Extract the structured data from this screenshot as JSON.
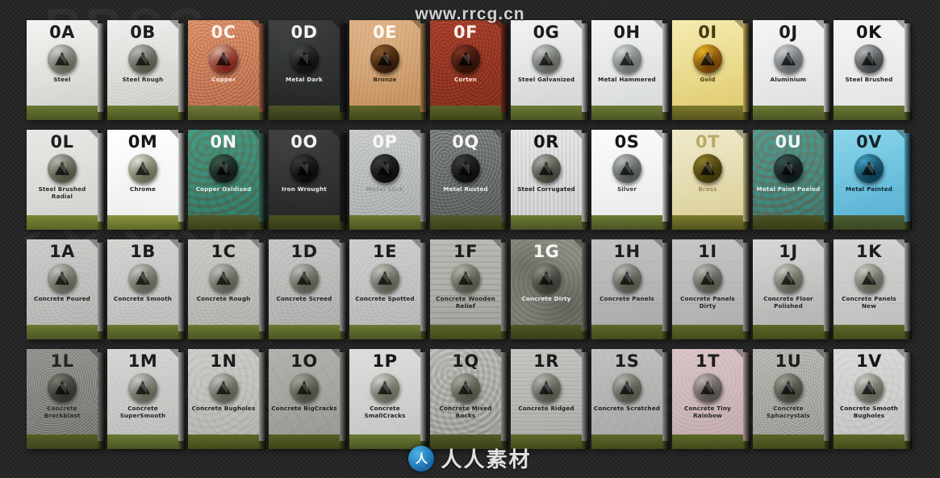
{
  "watermarks": {
    "top_center": "www.rrcg.cn",
    "logo_mark": "人",
    "logo_text": "人人素材",
    "background_repeats": [
      "RRCG",
      "www.rrcg.cn",
      "人人素材",
      "RRCG"
    ]
  },
  "grid": {
    "columns": 11,
    "rows": 4,
    "tiles": [
      {
        "code": "0A",
        "label": "Steel",
        "face_top": "#f2f2f0",
        "face_bot": "#d4d4d0",
        "side": "#b8b8b4",
        "base_top": "#6b7a33",
        "base_bot": "#4a5524",
        "code_color": "#1c1c1c",
        "label_color": "#262626",
        "knob_a": "#cfd2cf",
        "knob_b": "#5d6153",
        "texture": "smooth"
      },
      {
        "code": "0B",
        "label": "Steel Rough",
        "face_top": "#efefee",
        "face_bot": "#cfcfca",
        "side": "#b4b4b0",
        "base_top": "#6b7a33",
        "base_bot": "#49541f",
        "code_color": "#1c1c1c",
        "label_color": "#2a2a2a",
        "knob_a": "#b9bcb7",
        "knob_b": "#4f5346",
        "texture": "rough"
      },
      {
        "code": "0C",
        "label": "Copper",
        "face_top": "#d98f6a",
        "face_bot": "#b96f4e",
        "side": "#9a5a3e",
        "base_top": "#6e7b38",
        "base_bot": "#4d5622",
        "code_color": "#fdf2ec",
        "label_color": "#fbe8df",
        "knob_a": "#d9b09a",
        "knob_b": "#7a1c14",
        "texture": "rough"
      },
      {
        "code": "0D",
        "label": "Metal Dark",
        "face_top": "#3a3c3d",
        "face_bot": "#232526",
        "side": "#1a1c1d",
        "base_top": "#4c5425",
        "base_bot": "#343a18",
        "code_color": "#f4f4f4",
        "label_color": "#e8e8e8",
        "knob_a": "#4a4c4d",
        "knob_b": "#0c0d0e",
        "texture": "smoke"
      },
      {
        "code": "0E",
        "label": "Bronze",
        "face_top": "#ddb083",
        "face_bot": "#c4905f",
        "side": "#a2764c",
        "base_top": "#5e6528",
        "base_bot": "#41481a",
        "code_color": "#fffaf2",
        "label_color": "#3b2615",
        "knob_a": "#8a5a2e",
        "knob_b": "#2f1708",
        "texture": "paper"
      },
      {
        "code": "0F",
        "label": "Corten",
        "face_top": "#a63f2b",
        "face_bot": "#86301f",
        "side": "#6e2717",
        "base_top": "#5c6429",
        "base_bot": "#3f4618",
        "code_color": "#fff1ea",
        "label_color": "#fde3d8",
        "knob_a": "#7e3523",
        "knob_b": "#2b0f07",
        "texture": "rough"
      },
      {
        "code": "0G",
        "label": "Steel Galvanized",
        "face_top": "#f0f1f1",
        "face_bot": "#d6d8d8",
        "side": "#bbbdbd",
        "base_top": "#6b7a33",
        "base_bot": "#4a5524",
        "code_color": "#1b1b1b",
        "label_color": "#232323",
        "knob_a": "#c6c9c8",
        "knob_b": "#5b5f58",
        "texture": "smooth"
      },
      {
        "code": "0H",
        "label": "Metal Hammered",
        "face_top": "#f1f2f3",
        "face_bot": "#dadcdd",
        "side": "#bebfc0",
        "base_top": "#6b7a33",
        "base_bot": "#4a5524",
        "code_color": "#1b1b1b",
        "label_color": "#232323",
        "knob_a": "#d4d7d8",
        "knob_b": "#6a6e6c",
        "texture": "smooth"
      },
      {
        "code": "0I",
        "label": "Gold",
        "face_top": "#f4e9a8",
        "face_bot": "#e2cf78",
        "side": "#bda84f",
        "base_top": "#7b7a2c",
        "base_bot": "#56541c",
        "code_color": "#453a10",
        "label_color": "#4a3e12",
        "knob_a": "#e6b525",
        "knob_b": "#6b3a06",
        "texture": "smooth"
      },
      {
        "code": "0J",
        "label": "Aluminium",
        "face_top": "#f4f4f4",
        "face_bot": "#e2e2e2",
        "side": "#c5c5c5",
        "base_top": "#6b7a33",
        "base_bot": "#4a5524",
        "code_color": "#1b1b1b",
        "label_color": "#242424",
        "knob_a": "#cdd0d2",
        "knob_b": "#5f6466",
        "texture": "smooth"
      },
      {
        "code": "0K",
        "label": "Steel Brushed",
        "face_top": "#f5f5f5",
        "face_bot": "#e4e4e4",
        "side": "#c6c6c6",
        "base_top": "#6b7a33",
        "base_bot": "#4a5524",
        "code_color": "#141414",
        "label_color": "#222222",
        "knob_a": "#b8bbbc",
        "knob_b": "#3e4244",
        "texture": "brush"
      },
      {
        "code": "0L",
        "label": "Steel Brushed Radial",
        "face_top": "#e8e8e6",
        "face_bot": "#d3d3cf",
        "side": "#b5b5b1",
        "base_top": "#7d8736",
        "base_bot": "#5a6325",
        "code_color": "#1e1e1e",
        "label_color": "#2b2b2b",
        "knob_a": "#b6b8ae",
        "knob_b": "#4b4e3f",
        "texture": "radial"
      },
      {
        "code": "0M",
        "label": "Chrome",
        "face_top": "#ffffff",
        "face_bot": "#ededeb",
        "side": "#cfcfcd",
        "base_top": "#8b9440",
        "base_bot": "#5f6828",
        "code_color": "#161616",
        "label_color": "#242424",
        "knob_a": "#dfe2da",
        "knob_b": "#60664c",
        "texture": "chrome"
      },
      {
        "code": "0N",
        "label": "Copper Oxidised",
        "face_top": "#4f9b8a",
        "face_bot": "#3b7f72",
        "side": "#2f665c",
        "base_top": "#4f5a26",
        "base_bot": "#3a4219",
        "code_color": "#f4f7f5",
        "label_color": "#e4efe9",
        "knob_a": "#3a5a4c",
        "knob_b": "#101a15",
        "texture": "oxide"
      },
      {
        "code": "0O",
        "label": "Iron Wrought",
        "face_top": "#3c3c3c",
        "face_bot": "#262626",
        "side": "#1c1c1c",
        "base_top": "#4a5222",
        "base_bot": "#343a17",
        "code_color": "#f2f2f2",
        "label_color": "#ececec",
        "knob_a": "#3a3a3a",
        "knob_b": "#080808",
        "texture": "smoke"
      },
      {
        "code": "0P",
        "label": "Metal Slick",
        "face_top": "#c9cbcb",
        "face_bot": "#adb0b0",
        "side": "#939696",
        "base_top": "#6e7a33",
        "base_bot": "#4d5522",
        "code_color": "#f6f6f6",
        "label_color": "#8e9191",
        "knob_a": "#3c3e3e",
        "knob_b": "#0a0b0b",
        "texture": "rough"
      },
      {
        "code": "0Q",
        "label": "Metal Rusted",
        "face_top": "#7c7f80",
        "face_bot": "#5e6162",
        "side": "#4a4d4e",
        "base_top": "#525a27",
        "base_bot": "#3b421a",
        "code_color": "#f4f4f4",
        "label_color": "#ededed",
        "knob_a": "#3b3d3d",
        "knob_b": "#0b0c0c",
        "texture": "rough"
      },
      {
        "code": "0R",
        "label": "Steel Corrugated",
        "face_top": "#e3e4e4",
        "face_bot": "#cbcccc",
        "side": "#aeafaf",
        "base_top": "#6b7a33",
        "base_bot": "#4a5524",
        "code_color": "#151515",
        "label_color": "#1d1d1d",
        "knob_a": "#a9aca4",
        "knob_b": "#3b3f34",
        "texture": "corrugated"
      },
      {
        "code": "0S",
        "label": "Silver",
        "face_top": "#fbfbfb",
        "face_bot": "#ececec",
        "side": "#cdcdcd",
        "base_top": "#6b7a33",
        "base_bot": "#4a5524",
        "code_color": "#161616",
        "label_color": "#3a3a3a",
        "knob_a": "#b9bcbd",
        "knob_b": "#4d5152",
        "texture": "smooth"
      },
      {
        "code": "0T",
        "label": "Brass",
        "face_top": "#efe8c6",
        "face_bot": "#ddd3a0",
        "side": "#b9ae77",
        "base_top": "#7a7a2e",
        "base_bot": "#55551e",
        "code_color": "#b9ab68",
        "label_color": "#9c8f52",
        "knob_a": "#8d7c2a",
        "knob_b": "#3c3509",
        "texture": "smooth"
      },
      {
        "code": "0U",
        "label": "Metal Paint Peeled",
        "face_top": "#5d9b96",
        "face_bot": "#47817d",
        "side": "#386965",
        "base_top": "#4a5424",
        "base_bot": "#363d18",
        "code_color": "#eef5f4",
        "label_color": "#e2efed",
        "knob_a": "#3a5252",
        "knob_b": "#0e1616",
        "texture": "oxide"
      },
      {
        "code": "0V",
        "label": "Metal Painted",
        "face_top": "#7fd0e8",
        "face_bot": "#5fb7d6",
        "side": "#4a9ab8",
        "base_top": "#4d6038",
        "base_bot": "#39471f",
        "code_color": "#11262c",
        "label_color": "#10262c",
        "knob_a": "#3e9fc4",
        "knob_b": "#0c3b4d",
        "texture": "smooth"
      },
      {
        "code": "1A",
        "label": "Concrete Poured",
        "face_top": "#cbcbc9",
        "face_bot": "#b4b4b2",
        "side": "#9a9a98",
        "base_top": "#6b7a33",
        "base_bot": "#4a5524",
        "code_color": "#1d1d1d",
        "label_color": "#222222",
        "knob_a": "#c2c4bd",
        "knob_b": "#585c4e",
        "texture": "concrete"
      },
      {
        "code": "1B",
        "label": "Concrete Smooth",
        "face_top": "#d3d3d1",
        "face_bot": "#bcbcba",
        "side": "#a1a1a0",
        "base_top": "#6b7a33",
        "base_bot": "#4a5524",
        "code_color": "#1d1d1d",
        "label_color": "#222222",
        "knob_a": "#c6c8c1",
        "knob_b": "#5a5e50",
        "texture": "concrete"
      },
      {
        "code": "1C",
        "label": "Concrete Rough",
        "face_top": "#c9c9c6",
        "face_bot": "#b1b1ae",
        "side": "#979795",
        "base_top": "#6b7a33",
        "base_bot": "#4a5524",
        "code_color": "#1d1d1d",
        "label_color": "#222222",
        "knob_a": "#c0c2bb",
        "knob_b": "#55594b",
        "texture": "concrete"
      },
      {
        "code": "1D",
        "label": "Concrete Screed",
        "face_top": "#c6c6c4",
        "face_bot": "#aeaeac",
        "side": "#949492",
        "base_top": "#6b7a33",
        "base_bot": "#4a5524",
        "code_color": "#1d1d1d",
        "label_color": "#222222",
        "knob_a": "#bcbeb7",
        "knob_b": "#525648",
        "texture": "concrete"
      },
      {
        "code": "1E",
        "label": "Concrete Spotted",
        "face_top": "#cecece",
        "face_bot": "#b7b7b7",
        "side": "#9c9c9c",
        "base_top": "#6b7a33",
        "base_bot": "#4a5524",
        "code_color": "#1d1d1d",
        "label_color": "#222222",
        "knob_a": "#c2c4bd",
        "knob_b": "#56594c",
        "texture": "concrete"
      },
      {
        "code": "1F",
        "label": "Concrete Wooden Relief",
        "face_top": "#b8b8b2",
        "face_bot": "#a0a09a",
        "side": "#878781",
        "base_top": "#5b6528",
        "base_bot": "#41481a",
        "code_color": "#1d1d1d",
        "label_color": "#222222",
        "knob_a": "#b4b6ad",
        "knob_b": "#4c5043",
        "texture": "wood"
      },
      {
        "code": "1G",
        "label": "Concrete Dirty",
        "face_top": "#8f9288",
        "face_bot": "#76796f",
        "side": "#63665c",
        "base_top": "#4e5724",
        "base_bot": "#383f18",
        "code_color": "#f6f6f6",
        "label_color": "#f0f0f0",
        "knob_a": "#8e9188",
        "knob_b": "#33372c",
        "texture": "dirty"
      },
      {
        "code": "1H",
        "label": "Concrete Panels",
        "face_top": "#c0c2c1",
        "face_bot": "#a8aaa9",
        "side": "#8e908f",
        "base_top": "#5e6829",
        "base_bot": "#434a1b",
        "code_color": "#1d1d1d",
        "label_color": "#242424",
        "knob_a": "#b5b7b0",
        "knob_b": "#4d5145",
        "texture": "panels"
      },
      {
        "code": "1I",
        "label": "Concrete Panels Dirty",
        "face_top": "#c4c6c5",
        "face_bot": "#acaead",
        "side": "#929493",
        "base_top": "#5e6829",
        "base_bot": "#434a1b",
        "code_color": "#1d1d1d",
        "label_color": "#242424",
        "knob_a": "#b8bab3",
        "knob_b": "#4f5347",
        "texture": "panels"
      },
      {
        "code": "1J",
        "label": "Concrete Floor Polished",
        "face_top": "#d0d0ce",
        "face_bot": "#b9b9b7",
        "side": "#9e9e9c",
        "base_top": "#5e6829",
        "base_bot": "#434a1b",
        "code_color": "#1d1d1d",
        "label_color": "#222222",
        "knob_a": "#c8cac3",
        "knob_b": "#5a5e50",
        "texture": "polished"
      },
      {
        "code": "1K",
        "label": "Concrete Panels New",
        "face_top": "#d4d4d2",
        "face_bot": "#bdbdbb",
        "side": "#a2a2a0",
        "base_top": "#5e6829",
        "base_bot": "#434a1b",
        "code_color": "#1d1d1d",
        "label_color": "#222222",
        "knob_a": "#c9cbc4",
        "knob_b": "#5c6052",
        "texture": "panels"
      },
      {
        "code": "1L",
        "label": "Concrete Brockblast",
        "face_top": "#9b9b96",
        "face_bot": "#83837e",
        "side": "#6e6e6a",
        "base_top": "#555e27",
        "base_bot": "#3d441a",
        "code_color": "#242424",
        "label_color": "#2a2a2a",
        "knob_a": "#7b7d74",
        "knob_b": "#2b2e25",
        "texture": "blast"
      },
      {
        "code": "1M",
        "label": "Concrete SuperSmooth",
        "face_top": "#d5d5d3",
        "face_bot": "#bebebc",
        "side": "#a3a3a1",
        "base_top": "#6b7a33",
        "base_bot": "#4a5524",
        "code_color": "#1c1c1c",
        "label_color": "#222222",
        "knob_a": "#c9cbc4",
        "knob_b": "#5a5e50",
        "texture": "concrete"
      },
      {
        "code": "1N",
        "label": "Concrete Bugholes",
        "face_top": "#cbcbc8",
        "face_bot": "#b3b3b0",
        "side": "#989896",
        "base_top": "#5e6829",
        "base_bot": "#434a1b",
        "code_color": "#1c1c1c",
        "label_color": "#222222",
        "knob_a": "#c0c2bb",
        "knob_b": "#55594b",
        "texture": "bugholes"
      },
      {
        "code": "1O",
        "label": "Concrete BigCracks",
        "face_top": "#b3b3ae",
        "face_bot": "#9b9b96",
        "side": "#838380",
        "base_top": "#566027",
        "base_bot": "#3e4519",
        "code_color": "#1c1c1c",
        "label_color": "#222222",
        "knob_a": "#a6a89f",
        "knob_b": "#464a3d",
        "texture": "cracks"
      },
      {
        "code": "1P",
        "label": "Concrete SmallCracks",
        "face_top": "#dededc",
        "face_bot": "#c7c7c5",
        "side": "#acacaa",
        "base_top": "#6b7a33",
        "base_bot": "#4a5524",
        "code_color": "#161616",
        "label_color": "#1e1e1e",
        "knob_a": "#cfd1ca",
        "knob_b": "#5f6355",
        "texture": "cracks"
      },
      {
        "code": "1Q",
        "label": "Concrete Mixed Rocks",
        "face_top": "#b9b9b4",
        "face_bot": "#a1a19c",
        "side": "#888885",
        "base_top": "#515a25",
        "base_bot": "#3a4118",
        "code_color": "#1c1c1c",
        "label_color": "#222222",
        "knob_a": "#abada4",
        "knob_b": "#494d40",
        "texture": "rocks"
      },
      {
        "code": "1R",
        "label": "Concrete Ridged",
        "face_top": "#c3c3c0",
        "face_bot": "#ababa8",
        "side": "#919190",
        "base_top": "#5e6829",
        "base_bot": "#434a1b",
        "code_color": "#1c1c1c",
        "label_color": "#222222",
        "knob_a": "#b6b8b1",
        "knob_b": "#4d5145",
        "texture": "ridged"
      },
      {
        "code": "1S",
        "label": "Concrete Scratched",
        "face_top": "#c0c0be",
        "face_bot": "#a8a8a6",
        "side": "#8e8e8c",
        "base_top": "#5e6829",
        "base_bot": "#434a1b",
        "code_color": "#1c1c1c",
        "label_color": "#222222",
        "knob_a": "#b3b5ae",
        "knob_b": "#4b4f43",
        "texture": "scratched"
      },
      {
        "code": "1T",
        "label": "Concrete Tiny Rainbow",
        "face_top": "#d9c3c5",
        "face_bot": "#c2acae",
        "side": "#a79395",
        "base_top": "#5e6829",
        "base_bot": "#434a1b",
        "code_color": "#1c1c1c",
        "label_color": "#222222",
        "knob_a": "#bdb3b0",
        "knob_b": "#514b47",
        "texture": "rainbow"
      },
      {
        "code": "1U",
        "label": "Concrete Sphacrystals",
        "face_top": "#bbbbb6",
        "face_bot": "#a3a39e",
        "side": "#8a8a86",
        "base_top": "#5b6527",
        "base_bot": "#42481a",
        "code_color": "#1c1c1c",
        "label_color": "#2a2a2a",
        "knob_a": "#9c9e95",
        "knob_b": "#3e4236",
        "texture": "crystals"
      },
      {
        "code": "1V",
        "label": "Concrete Smooth Bugholes",
        "face_top": "#dadad8",
        "face_bot": "#c3c3c1",
        "side": "#a8a8a6",
        "base_top": "#5e6829",
        "base_bot": "#434a1b",
        "code_color": "#141414",
        "label_color": "#1c1c1c",
        "knob_a": "#cdcfc8",
        "knob_b": "#5d6153",
        "texture": "bugholes"
      }
    ]
  }
}
